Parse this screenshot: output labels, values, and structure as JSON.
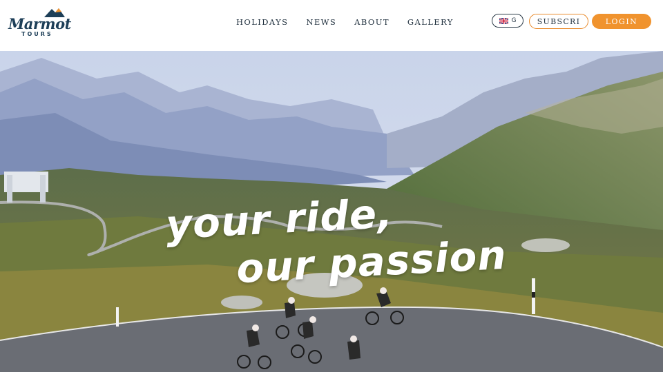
{
  "brand": {
    "name": "Marmot",
    "sub": "TOURS"
  },
  "nav": {
    "items": [
      {
        "label": "HOLIDAYS"
      },
      {
        "label": "NEWS"
      },
      {
        "label": "ABOUT"
      },
      {
        "label": "GALLERY"
      }
    ]
  },
  "language": {
    "code": "G"
  },
  "actions": {
    "subscribe_label": "SUBSCRI",
    "login_label": "LOGIN"
  },
  "hero": {
    "line1": "your ride,",
    "line2": "our passion"
  },
  "colors": {
    "accent": "#f0932e",
    "navy": "#1d3e57",
    "text": "#1f2f3d"
  }
}
